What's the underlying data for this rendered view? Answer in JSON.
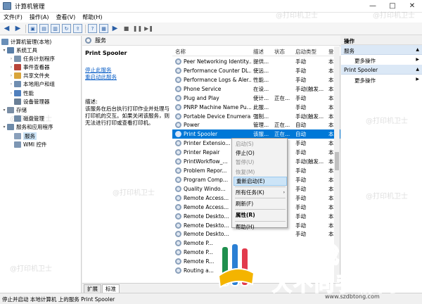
{
  "window": {
    "title": "计算机管理",
    "controls": [
      "—",
      "□",
      "✕"
    ]
  },
  "menu": [
    "文件(F)",
    "操作(A)",
    "查看(V)",
    "帮助(H)"
  ],
  "tree": {
    "root": "计算机管理(本地)",
    "items": [
      {
        "label": "系统工具",
        "level": 1,
        "twisty": "▾",
        "color": "#5a7fa8"
      },
      {
        "label": "任务计划程序",
        "level": 2,
        "twisty": "›",
        "color": "#7b93ad"
      },
      {
        "label": "事件查看器",
        "level": 2,
        "twisty": "›",
        "color": "#b9463a"
      },
      {
        "label": "共享文件夹",
        "level": 2,
        "twisty": "›",
        "color": "#d9a53b"
      },
      {
        "label": "本地用户和组",
        "level": 2,
        "twisty": "›",
        "color": "#6f8db0"
      },
      {
        "label": "性能",
        "level": 2,
        "twisty": "›",
        "color": "#4f7fbd"
      },
      {
        "label": "设备管理器",
        "level": 2,
        "twisty": "",
        "color": "#6a7f96"
      },
      {
        "label": "存储",
        "level": 1,
        "twisty": "▾",
        "color": "#7a8ea5"
      },
      {
        "label": "磁盘管理",
        "level": 2,
        "twisty": "",
        "color": "#6e8aa8"
      },
      {
        "label": "服务和应用程序",
        "level": 1,
        "twisty": "▾",
        "color": "#6e8aa8"
      },
      {
        "label": "服务",
        "level": 2,
        "twisty": "",
        "color": "#8aa0bb",
        "selected": true
      },
      {
        "label": "WMI 控件",
        "level": 2,
        "twisty": "",
        "color": "#7d96b3"
      }
    ]
  },
  "middle": {
    "header": "服务",
    "service_title": "Print Spooler",
    "stop_link": "停止此服务",
    "restart_link": "重启动此服务",
    "desc_label": "描述:",
    "desc_text": [
      "该服务在后台执行打印作业并处理与",
      "打印机的交互。如果关闭该服务，则",
      "无法进行打印或查看打印机。"
    ],
    "columns": {
      "name": "名称",
      "desc": "描述",
      "status": "状态",
      "startup": "启动类型",
      "logon": "登"
    },
    "rows": [
      {
        "name": "Peer Networking Identity...",
        "desc": "提供...",
        "status": "",
        "startup": "手动",
        "logon": "本"
      },
      {
        "name": "Performance Counter DL...",
        "desc": "使远...",
        "status": "",
        "startup": "手动",
        "logon": "本"
      },
      {
        "name": "Performance Logs & Aler...",
        "desc": "性能...",
        "status": "",
        "startup": "手动",
        "logon": "本"
      },
      {
        "name": "Phone Service",
        "desc": "在设...",
        "status": "",
        "startup": "手动(触发...",
        "logon": "本"
      },
      {
        "name": "Plug and Play",
        "desc": "使计...",
        "status": "正在...",
        "startup": "手动",
        "logon": "本"
      },
      {
        "name": "PNRP Machine Name Pu...",
        "desc": "此服...",
        "status": "",
        "startup": "手动",
        "logon": "本"
      },
      {
        "name": "Portable Device Enumera...",
        "desc": "强制...",
        "status": "",
        "startup": "手动(触发...",
        "logon": "本"
      },
      {
        "name": "Power",
        "desc": "管理...",
        "status": "正在...",
        "startup": "自动",
        "logon": "本"
      },
      {
        "name": "Print Spooler",
        "desc": "该服...",
        "status": "正在...",
        "startup": "自动",
        "logon": "本",
        "selected": true
      },
      {
        "name": "Printer Extensio...",
        "desc": "",
        "status": "",
        "startup": "手动",
        "logon": "本"
      },
      {
        "name": "Printer Repair",
        "desc": "",
        "status": "",
        "startup": "手动",
        "logon": "本"
      },
      {
        "name": "PrintWorkflow_...",
        "desc": "",
        "status": "",
        "startup": "手动(触发...",
        "logon": "本"
      },
      {
        "name": "Problem Repor...",
        "desc": "",
        "status": "",
        "startup": "手动",
        "logon": "本"
      },
      {
        "name": "Program Comp...",
        "desc": "",
        "status": "",
        "startup": "手动",
        "logon": "本"
      },
      {
        "name": "Quality Windo...",
        "desc": "",
        "status": "",
        "startup": "手动",
        "logon": "本"
      },
      {
        "name": "Remote Access...",
        "desc": "",
        "status": "",
        "startup": "手动",
        "logon": "本"
      },
      {
        "name": "Remote Access...",
        "desc": "",
        "status": "",
        "startup": "手动",
        "logon": "本"
      },
      {
        "name": "Remote Deskto...",
        "desc": "",
        "status": "",
        "startup": "手动",
        "logon": "本"
      },
      {
        "name": "Remote Deskto...",
        "desc": "",
        "status": "",
        "startup": "手动",
        "logon": "本"
      },
      {
        "name": "Remote Deskto...",
        "desc": "",
        "status": "",
        "startup": "手动",
        "logon": "本"
      },
      {
        "name": "Remote P...",
        "desc": "",
        "status": "",
        "startup": "",
        "logon": ""
      },
      {
        "name": "Remote P...",
        "desc": "",
        "status": "",
        "startup": "",
        "logon": ""
      },
      {
        "name": "Remote R...",
        "desc": "",
        "status": "",
        "startup": "",
        "logon": ""
      },
      {
        "name": "Routing a...",
        "desc": "",
        "status": "",
        "startup": "",
        "logon": ""
      }
    ],
    "tabs": [
      "扩展",
      "标准"
    ]
  },
  "context_menu": {
    "items": [
      {
        "label": "启动(S)",
        "disabled": true
      },
      {
        "label": "停止(O)"
      },
      {
        "label": "暂停(U)",
        "disabled": true
      },
      {
        "label": "恢复(M)",
        "disabled": true
      },
      {
        "label": "重新启动(E)",
        "highlight": true
      },
      {
        "sep": true
      },
      {
        "label": "所有任务(K)",
        "submenu": "›"
      },
      {
        "sep": true
      },
      {
        "label": "刷新(F)"
      },
      {
        "sep": true
      },
      {
        "label": "属性(R)",
        "bold": true
      },
      {
        "sep": true
      },
      {
        "label": "帮助(H)"
      }
    ]
  },
  "actions": {
    "header": "操作",
    "groups": [
      {
        "title": "服务",
        "items": [
          "更多操作"
        ]
      },
      {
        "title": "Print Spooler",
        "items": [
          "更多操作"
        ]
      }
    ]
  },
  "status": "停止并启动 本地计算机 上的服务 Print Spooler",
  "watermarks": [
    "@打印机卫士"
  ],
  "overlay": {
    "line1": "欢欣游戏网",
    "line2": "大不同手游网",
    "url": "www.szdbtong.com"
  }
}
